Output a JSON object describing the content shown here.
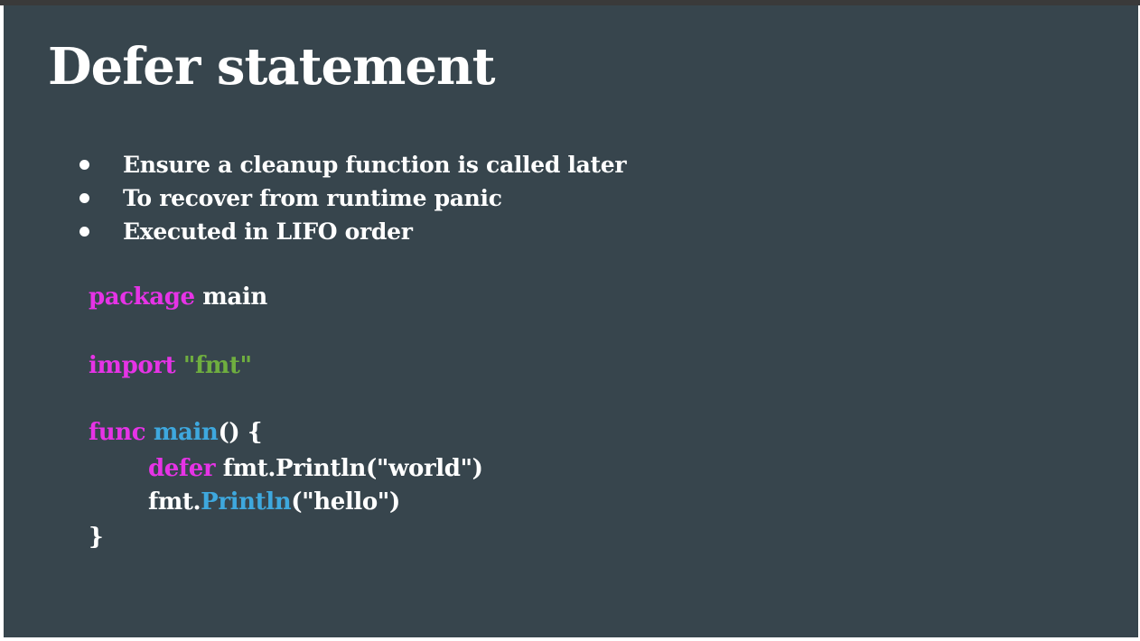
{
  "colors": {
    "slide_background": "#37454d",
    "text": "#ffffff",
    "keyword": "#e633e6",
    "function_name": "#3ea8de",
    "string_literal": "#6fae3f"
  },
  "slide": {
    "title": "Defer statement",
    "bullets": [
      "Ensure a cleanup function is called later",
      "To recover from runtime panic",
      "Executed in LIFO order"
    ],
    "code": {
      "line1": {
        "keyword": "package",
        "rest": " main"
      },
      "line2": {
        "keyword": "import",
        "string": " \"fmt\""
      },
      "line3": {
        "keyword": "func",
        "name": " main",
        "rest": "() {"
      },
      "line4": {
        "keyword": "defer",
        "rest": " fmt.Println(\"world\")"
      },
      "line5": {
        "prefix": "fmt.",
        "name": "Println",
        "rest": "(\"hello\")"
      },
      "line6": {
        "rest": "}"
      }
    }
  }
}
